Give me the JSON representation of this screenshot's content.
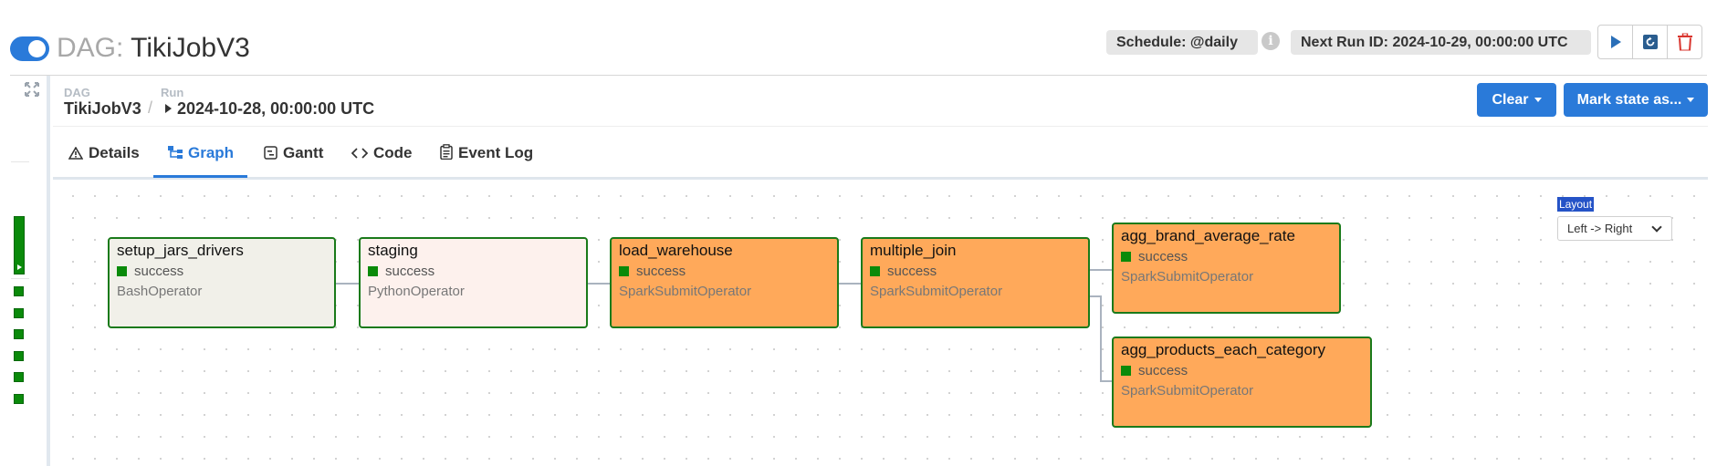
{
  "header": {
    "dag_prefix": "DAG:",
    "dag_name": "TikiJobV3",
    "schedule": "Schedule: @daily",
    "next_run": "Next Run ID: 2024-10-29, 00:00:00 UTC",
    "info_glyph": "i"
  },
  "breadcrumb": {
    "dag_label": "DAG",
    "dag_value": "TikiJobV3",
    "separator": "/",
    "run_label": "Run",
    "run_value": "2024-10-28, 00:00:00 UTC"
  },
  "actions": {
    "clear": "Clear",
    "mark_state": "Mark state as..."
  },
  "tabs": [
    {
      "label": "Details",
      "icon": "warning-icon"
    },
    {
      "label": "Graph",
      "icon": "graph-icon",
      "active": true
    },
    {
      "label": "Gantt",
      "icon": "gantt-icon"
    },
    {
      "label": "Code",
      "icon": "code-icon"
    },
    {
      "label": "Event Log",
      "icon": "clipboard-icon"
    }
  ],
  "graph": {
    "layout_label": "Layout",
    "layout_value": "Left -> Right",
    "tasks": [
      {
        "name": "setup_jars_drivers",
        "state": "success",
        "operator": "BashOperator"
      },
      {
        "name": "staging",
        "state": "success",
        "operator": "PythonOperator"
      },
      {
        "name": "load_warehouse",
        "state": "success",
        "operator": "SparkSubmitOperator"
      },
      {
        "name": "multiple_join",
        "state": "success",
        "operator": "SparkSubmitOperator"
      },
      {
        "name": "agg_brand_average_rate",
        "state": "success",
        "operator": "SparkSubmitOperator"
      },
      {
        "name": "agg_products_each_category",
        "state": "success",
        "operator": "SparkSubmitOperator"
      }
    ]
  },
  "colors": {
    "accent": "#2a7ad9",
    "success": "#0a8a0a",
    "bash_fill": "#f1f0e9",
    "python_fill": "#fdf1ed",
    "spark_fill": "#ffa95a"
  }
}
